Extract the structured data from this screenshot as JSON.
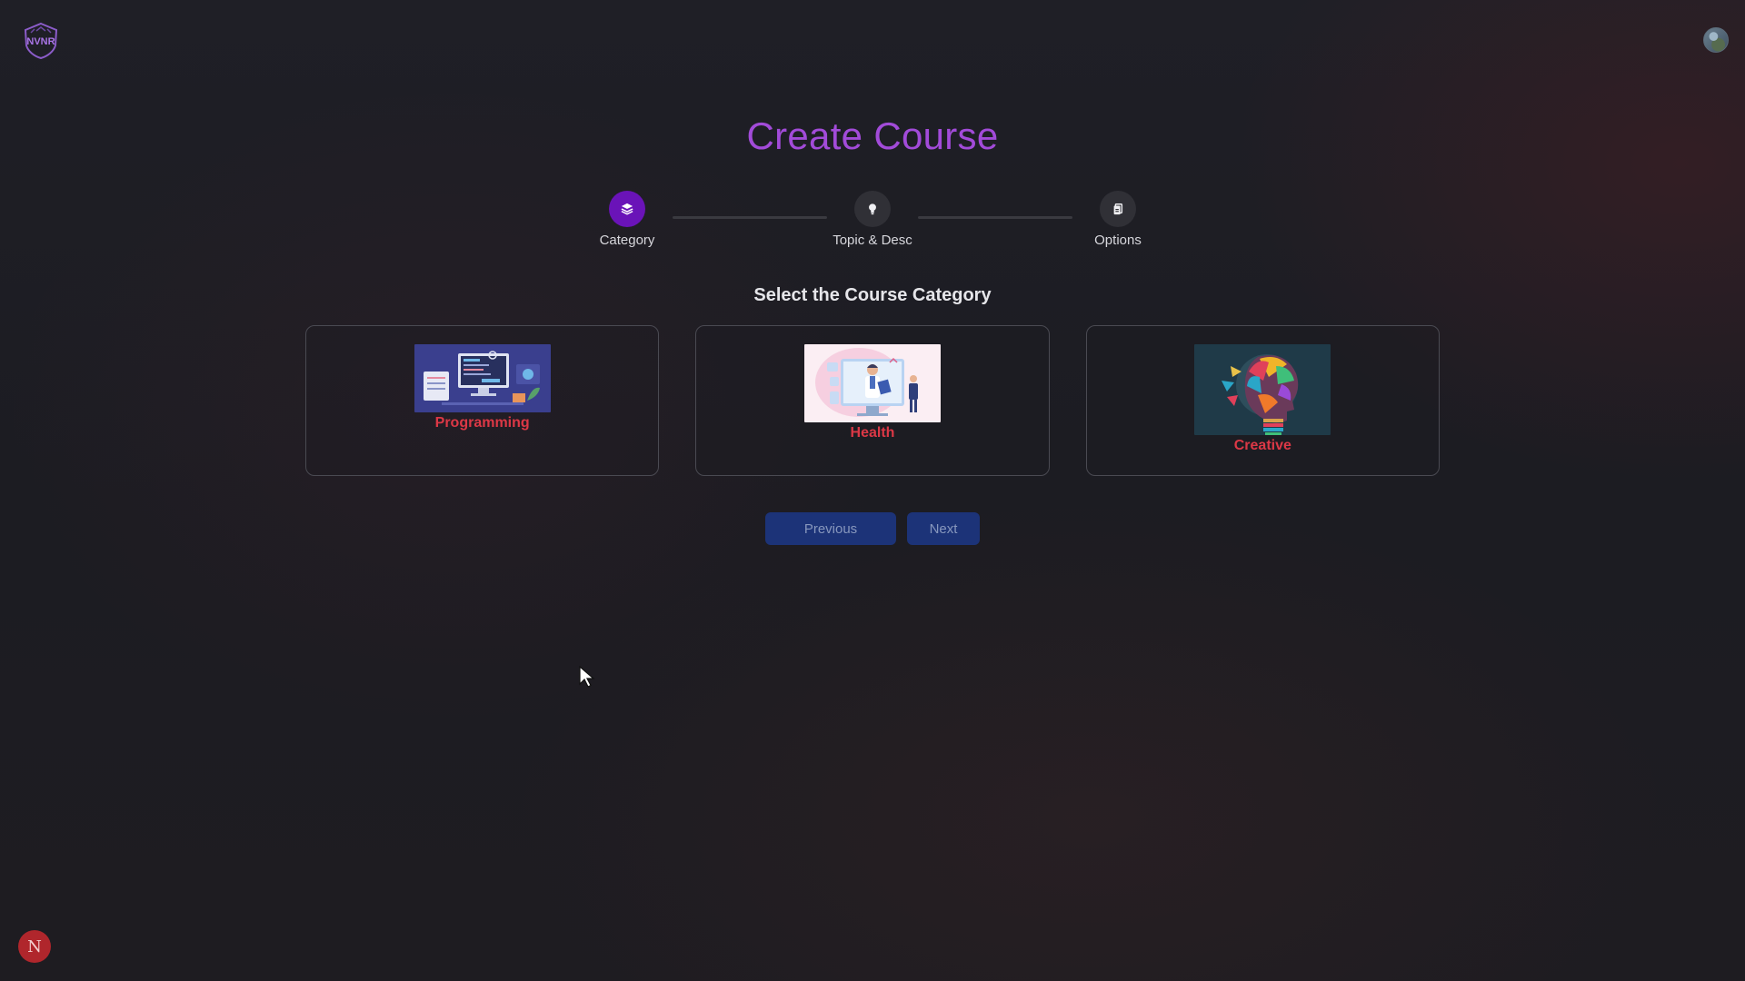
{
  "header": {
    "logo_text": "NVNR",
    "avatar_alt": "user avatar"
  },
  "page": {
    "title": "Create Course",
    "section_title": "Select the Course Category"
  },
  "stepper": {
    "current_step": 1,
    "steps": [
      {
        "label": "Category",
        "icon": "layers-icon",
        "active": true
      },
      {
        "label": "Topic & Desc",
        "icon": "lightbulb-icon",
        "active": false
      },
      {
        "label": "Options",
        "icon": "clipboard-icon",
        "active": false
      }
    ]
  },
  "categories": [
    {
      "label": "Programming",
      "image": "programming-illustration"
    },
    {
      "label": "Health",
      "image": "health-illustration"
    },
    {
      "label": "Creative",
      "image": "creative-head-illustration"
    }
  ],
  "buttons": {
    "previous": "Previous",
    "next": "Next"
  },
  "badge": {
    "letter": "N"
  },
  "colors": {
    "accent_purple": "#a24bd9",
    "step_active": "#6a13b8",
    "category_label": "#dc3846",
    "button_bg": "#1c3378",
    "badge_bg": "#b0262c"
  }
}
